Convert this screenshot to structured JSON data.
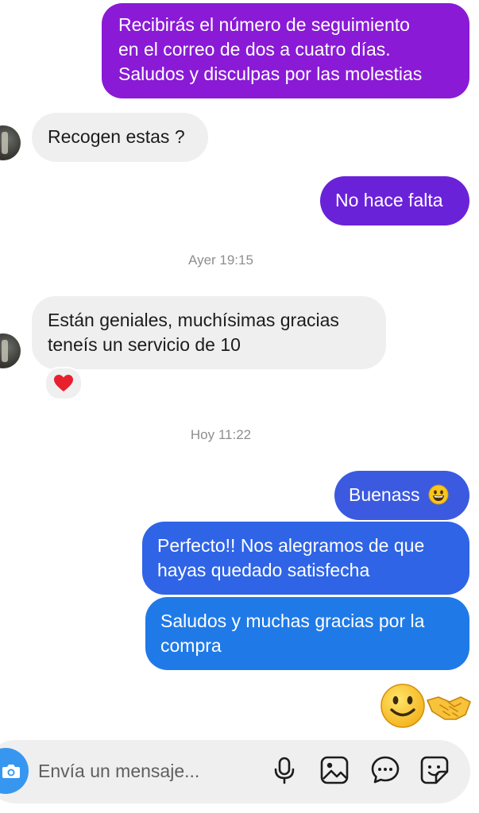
{
  "messages": {
    "m1": [
      "Recibirás el número de seguimiento",
      "en el correo de dos a cuatro días.",
      "Saludos y disculpas por las molestias"
    ],
    "m2": [
      "Recogen estas ?"
    ],
    "m3": [
      "No hace falta"
    ],
    "m4": [
      "Están geniales, muchísimas gracias",
      "teneís un servicio de 10"
    ],
    "m5": [
      "Buenass"
    ],
    "m6": [
      "Perfecto!! Nos alegramos de que",
      "hayas quedado satisfecha"
    ],
    "m7": [
      "Saludos y muchas gracias por la",
      "compra"
    ]
  },
  "timestamps": {
    "t1": "Ayer 19:15",
    "t2": "Hoy 11:22"
  },
  "reactions": {
    "m4": "heart"
  },
  "composer": {
    "placeholder": "Envía un mensaje...",
    "icons": [
      "camera-icon",
      "microphone-icon",
      "gallery-icon",
      "chat-bubble-icon",
      "sticker-icon"
    ]
  },
  "colors": {
    "outgoing_purple": "#8a1ad6",
    "outgoing_violet": "#6a22d8",
    "outgoing_blue": "#2f64e6",
    "incoming_gray": "#efefef",
    "camera_blue": "#3797f0"
  },
  "emojis": [
    "grinning-face",
    "slightly-smiling-face",
    "handshake"
  ]
}
